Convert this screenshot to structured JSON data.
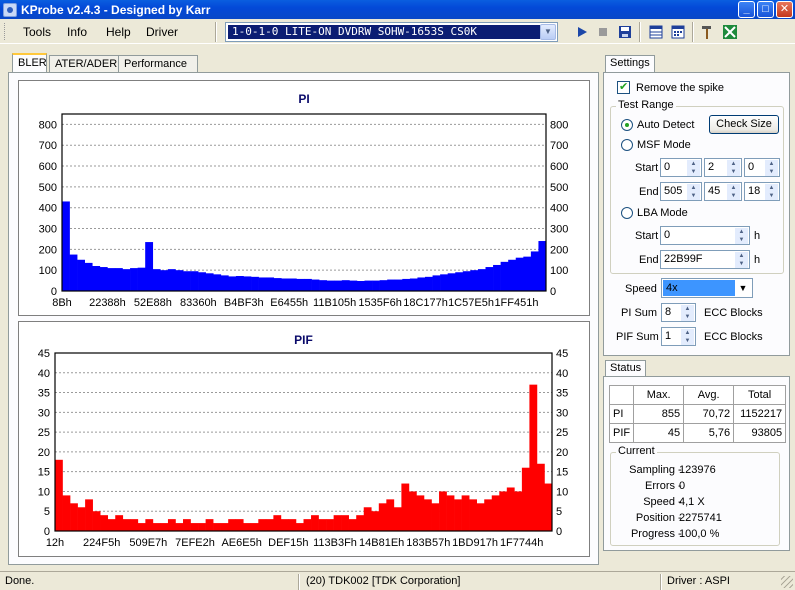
{
  "window": {
    "title": "KProbe v2.4.3 - Designed by Karr",
    "buttons": [
      "_",
      "□",
      "✕"
    ]
  },
  "menu": [
    "Tools",
    "Info",
    "Help",
    "Driver"
  ],
  "drive_select": {
    "value": "1-0-1-0 LITE-ON DVDRW SOHW-1653S CS0K"
  },
  "toolbar": {
    "icons": [
      "play-icon",
      "stop-icon",
      "save-icon",
      "layout-icon",
      "calendar-icon",
      "tools-icon",
      "exit-icon"
    ]
  },
  "tabs": [
    "BLER",
    "ATER/ADER",
    "Performance"
  ],
  "chart_data": [
    {
      "type": "bar",
      "title": "PI",
      "ylim": [
        0,
        850
      ],
      "yticks": [
        0,
        100,
        200,
        300,
        400,
        500,
        600,
        700,
        800
      ],
      "xticks": [
        "8Bh",
        "22388h",
        "52E88h",
        "83360h",
        "B4BF3h",
        "E6455h",
        "11B105h",
        "1535F6h",
        "18C177h",
        "1C57E5h",
        "1FF451h"
      ],
      "grid": true,
      "color": "#0000ff",
      "series": [
        {
          "values": [
            430,
            175,
            150,
            135,
            120,
            115,
            110,
            110,
            105,
            110,
            112,
            235,
            105,
            100,
            105,
            100,
            95,
            95,
            90,
            85,
            80,
            75,
            70,
            72,
            70,
            68,
            65,
            65,
            62,
            60,
            60,
            58,
            58,
            55,
            52,
            50,
            50,
            52,
            50,
            48,
            50,
            50,
            52,
            55,
            55,
            58,
            60,
            65,
            68,
            75,
            80,
            85,
            90,
            95,
            100,
            105,
            115,
            125,
            140,
            150,
            160,
            165,
            190,
            240
          ]
        }
      ]
    },
    {
      "type": "bar",
      "title": "PIF",
      "ylim": [
        0,
        45
      ],
      "yticks": [
        0,
        5,
        10,
        15,
        20,
        25,
        30,
        35,
        40,
        45
      ],
      "xticks": [
        "12h",
        "224F5h",
        "509E7h",
        "7EFE2h",
        "AE6E5h",
        "DEF15h",
        "113B3Fh",
        "14B81Eh",
        "183B57h",
        "1BD917h",
        "1F7744h"
      ],
      "grid": true,
      "color": "#ff0000",
      "series": [
        {
          "values": [
            18,
            9,
            7,
            6,
            8,
            5,
            4,
            3,
            4,
            3,
            3,
            2,
            3,
            2,
            2,
            3,
            2,
            3,
            2,
            2,
            3,
            2,
            2,
            3,
            3,
            2,
            2,
            3,
            3,
            4,
            3,
            3,
            2,
            3,
            4,
            3,
            3,
            4,
            4,
            3,
            4,
            6,
            5,
            7,
            8,
            6,
            12,
            10,
            9,
            8,
            7,
            10,
            9,
            8,
            9,
            8,
            7,
            8,
            9,
            10,
            11,
            10,
            16,
            37,
            17,
            12
          ]
        }
      ]
    }
  ],
  "settings": {
    "title": "Settings",
    "remove_spike": "Remove the spike",
    "test_range": "Test Range",
    "auto_detect": "Auto Detect",
    "check_size": "Check Size",
    "msf_mode": "MSF Mode",
    "start_label": "Start",
    "end_label": "End",
    "msf_start": [
      "0",
      "2",
      "0"
    ],
    "msf_end": [
      "505",
      "45",
      "18"
    ],
    "lba_mode": "LBA Mode",
    "lba_start": "0",
    "lba_end": "22B99F",
    "h": "h",
    "speed_label": "Speed",
    "speed_value": "4x",
    "pi_sum_label": "PI Sum",
    "pi_sum": "8",
    "pif_sum_label": "PIF Sum",
    "pif_sum": "1",
    "ecc_blocks": "ECC Blocks"
  },
  "status": {
    "title": "Status",
    "table": {
      "headers": [
        "",
        "Max.",
        "Avg.",
        "Total"
      ],
      "rows": [
        [
          "PI",
          "855",
          "70,72",
          "1152217"
        ],
        [
          "PIF",
          "45",
          "5,76",
          "93805"
        ]
      ]
    },
    "current_title": "Current",
    "current": [
      {
        "label": "Sampling",
        "value": "123976"
      },
      {
        "label": "Errors",
        "value": "0"
      },
      {
        "label": "Speed",
        "value": "4,1  X"
      },
      {
        "label": "Position",
        "value": "2275741"
      },
      {
        "label": "Progress",
        "value": "100,0 %"
      }
    ]
  },
  "statusbar": {
    "left": "Done.",
    "middle": "(20) TDK002 [TDK Corporation]",
    "right": "Driver : ASPI"
  }
}
